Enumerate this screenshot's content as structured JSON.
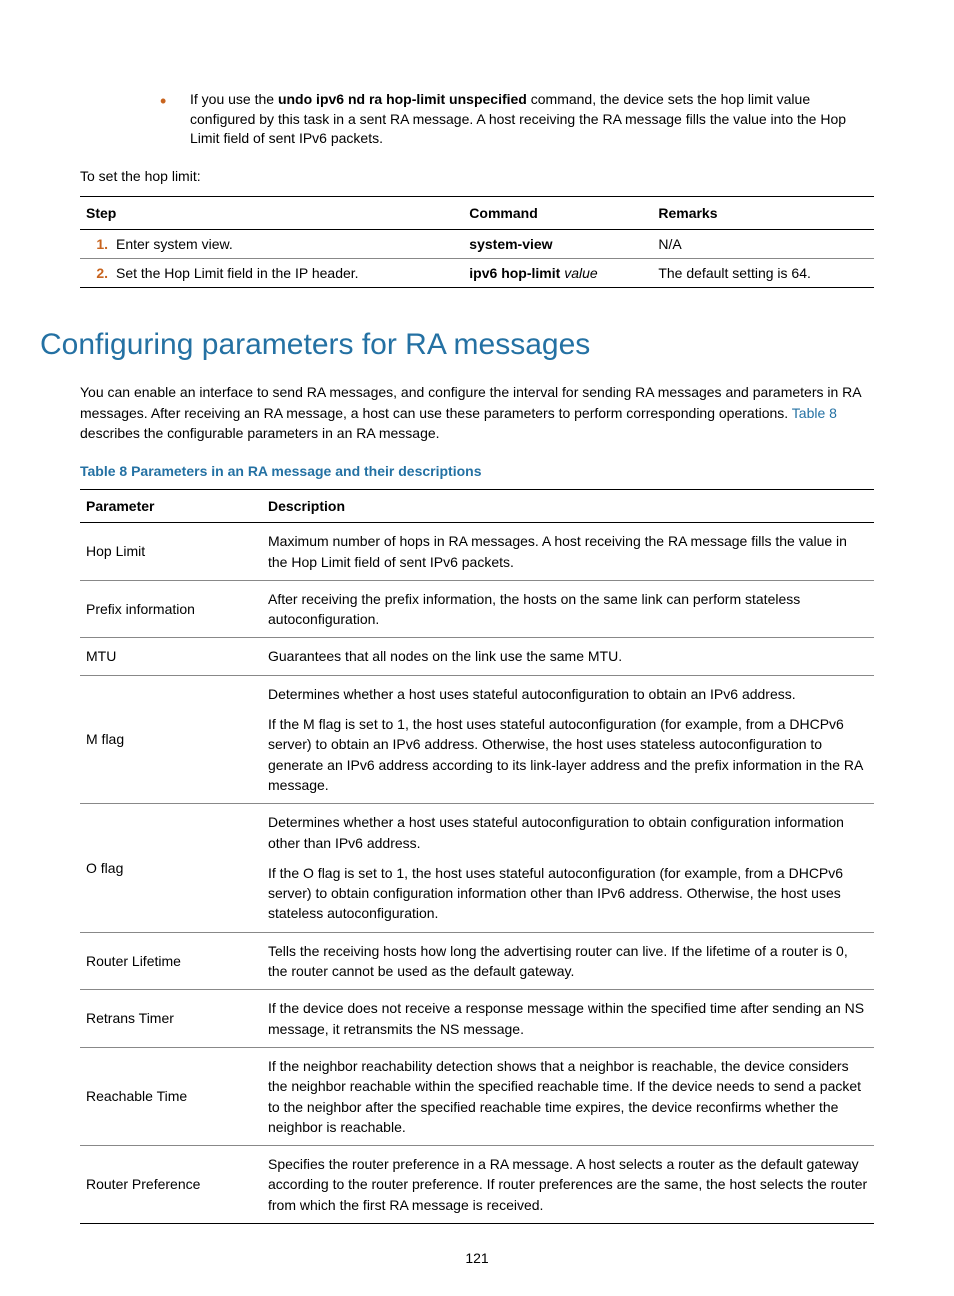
{
  "bullet": {
    "pre": "If you use the ",
    "cmd": "undo ipv6 nd ra hop-limit unspecified",
    "post": " command, the device sets the hop limit value configured by this task in a sent RA message. A host receiving the RA message fills the value into the Hop Limit field of sent IPv6 packets."
  },
  "pre_steps_line": "To set the hop limit:",
  "steps_table": {
    "headers": [
      "Step",
      "Command",
      "Remarks"
    ],
    "rows": [
      {
        "idx": "1.",
        "step": "Enter system view.",
        "cmd_bold": "system-view",
        "cmd_italic": "",
        "remarks": "N/A"
      },
      {
        "idx": "2.",
        "step": "Set the Hop Limit field in the IP header.",
        "cmd_bold": "ipv6 hop-limit ",
        "cmd_italic": "value",
        "remarks": "The default setting is 64."
      }
    ]
  },
  "section_heading": "Configuring parameters for RA messages",
  "section_para_pre": "You can enable an interface to send RA messages, and configure the interval for sending RA messages and parameters in RA messages. After receiving an RA message, a host can use these parameters to perform corresponding operations. ",
  "section_para_link": "Table 8",
  "section_para_post": " describes the configurable parameters in an RA message.",
  "table_caption": "Table 8 Parameters in an RA message and their descriptions",
  "params_table": {
    "headers": [
      "Parameter",
      "Description"
    ],
    "rows": [
      {
        "name": "Hop Limit",
        "desc": [
          "Maximum number of hops in RA messages. A host receiving the RA message fills the value in the Hop Limit field of sent IPv6 packets."
        ]
      },
      {
        "name": "Prefix information",
        "desc": [
          "After receiving the prefix information, the hosts on the same link can perform stateless autoconfiguration."
        ]
      },
      {
        "name": "MTU",
        "desc": [
          "Guarantees that all nodes on the link use the same MTU."
        ]
      },
      {
        "name": "M flag",
        "desc": [
          "Determines whether a host uses stateful autoconfiguration to obtain an IPv6 address.",
          "If the M flag is set to 1, the host uses stateful autoconfiguration (for example, from a DHCPv6 server) to obtain an IPv6 address. Otherwise, the host uses stateless autoconfiguration to generate an IPv6 address according to its link-layer address and the prefix information in the RA message."
        ]
      },
      {
        "name": "O flag",
        "desc": [
          "Determines whether a host uses stateful autoconfiguration to obtain configuration information other than IPv6 address.",
          "If the O flag is set to 1, the host uses stateful autoconfiguration (for example, from a DHCPv6 server) to obtain configuration information other than IPv6 address. Otherwise, the host uses stateless autoconfiguration."
        ]
      },
      {
        "name": "Router Lifetime",
        "desc": [
          "Tells the receiving hosts how long the advertising router can live. If the lifetime of a router is 0, the router cannot be used as the default gateway."
        ]
      },
      {
        "name": "Retrans Timer",
        "desc": [
          "If the device does not receive a response message within the specified time after sending an NS message, it retransmits the NS message."
        ]
      },
      {
        "name": "Reachable Time",
        "desc": [
          "If the neighbor reachability detection shows that a neighbor is reachable, the device considers the neighbor reachable within the specified reachable time. If the device needs to send a packet to the neighbor after the specified reachable time expires, the device reconfirms whether the neighbor is reachable."
        ]
      },
      {
        "name": "Router Preference",
        "desc": [
          "Specifies the router preference in a RA message. A host selects a router as the default gateway according to the router preference. If router preferences are the same, the host selects the router from which the first RA message is received."
        ]
      }
    ]
  },
  "page_number": "121"
}
